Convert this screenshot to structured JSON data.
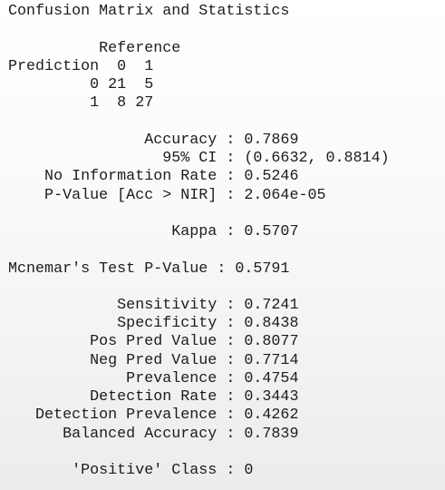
{
  "console": {
    "title": "Confusion Matrix and Statistics",
    "matrix": {
      "reference_header": "          Reference",
      "header_row": "Prediction  0  1",
      "row_0": "         0 21  5",
      "row_1": "         1  8 27"
    },
    "statistics": {
      "accuracy": "               Accuracy : 0.7869",
      "ci": "                 95% CI : (0.6632, 0.8814)",
      "nir": "    No Information Rate : 0.5246",
      "p_value": "    P-Value [Acc > NIR] : 2.064e-05",
      "kappa": "                  Kappa : 0.5707",
      "mcnemar": "Mcnemar's Test P-Value : 0.5791"
    },
    "class_stats": {
      "sensitivity": "            Sensitivity : 0.7241",
      "specificity": "            Specificity : 0.8438",
      "pos_pred": "         Pos Pred Value : 0.8077",
      "neg_pred": "         Neg Pred Value : 0.7714",
      "prevalence": "             Prevalence : 0.4754",
      "detection_rate": "         Detection Rate : 0.3443",
      "detection_prevalence": "   Detection Prevalence : 0.4262",
      "balanced_accuracy": "      Balanced Accuracy : 0.7839",
      "positive_class": "       'Positive' Class : 0"
    }
  }
}
